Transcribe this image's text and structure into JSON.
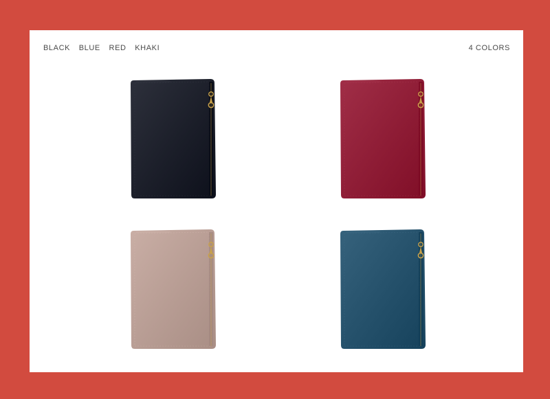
{
  "header": {
    "colors": [
      "BLACK",
      "BLUE",
      "RED",
      "KHAKI"
    ],
    "count_label": "4 COLORS"
  },
  "wallets": [
    {
      "color_name": "black",
      "hex": "#1b1e29"
    },
    {
      "color_name": "red",
      "hex": "#8e1c35"
    },
    {
      "color_name": "khaki",
      "hex": "#b79c93"
    },
    {
      "color_name": "blue",
      "hex": "#24506a"
    }
  ],
  "colors": {
    "frame": "#d24b3f",
    "panel": "#ffffff",
    "zipper": "#c9a24a"
  }
}
